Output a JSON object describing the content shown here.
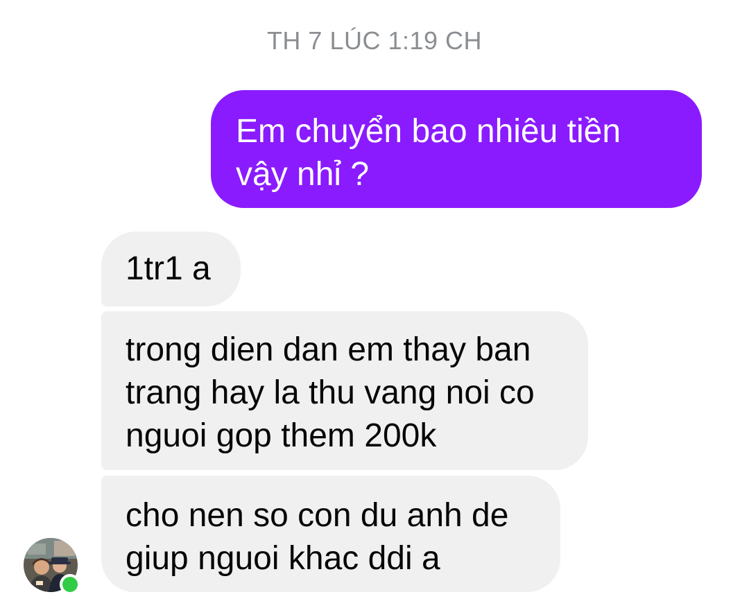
{
  "conversation": {
    "timestamp": "TH 7 LÚC 1:19 CH",
    "outgoing_message": "Em chuyển bao nhiêu tiền\nvậy nhỉ ?",
    "incoming_messages": [
      "1tr1 a",
      "trong dien dan em thay ban\ntrang hay la thu vang noi co\nnguoi gop them 200k",
      "cho nen so con du anh de\ngiup nguoi khac ddi a"
    ]
  },
  "colors": {
    "outgoing_bubble": "#8a1bff",
    "incoming_bubble": "#f0f0f0",
    "timestamp_text": "#8a8d91",
    "online_indicator": "#31cc46"
  },
  "icons": {
    "avatar": "contact-avatar-photo",
    "status": "online-status-dot"
  }
}
